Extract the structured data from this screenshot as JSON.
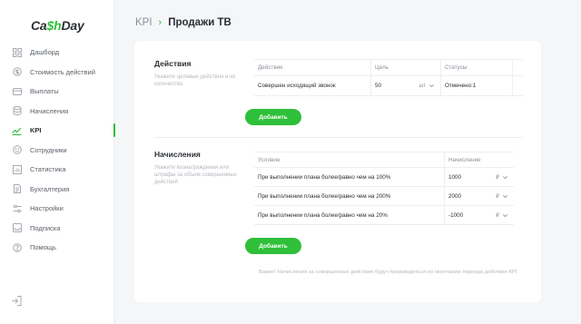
{
  "brand": {
    "name_pre": "Ca",
    "name_acc": "$h",
    "name_post": "Day",
    "accent_color": "#2fbf3a"
  },
  "sidebar": {
    "items": [
      {
        "label": "Дашборд",
        "icon": "dashboard-icon"
      },
      {
        "label": "Стоимость действий",
        "icon": "coin-icon"
      },
      {
        "label": "Выплаты",
        "icon": "wallet-icon"
      },
      {
        "label": "Начисления",
        "icon": "database-icon"
      },
      {
        "label": "KPI",
        "icon": "trend-icon",
        "active": true
      },
      {
        "label": "Сотрудники",
        "icon": "smile-icon"
      },
      {
        "label": "Статистика",
        "icon": "bar-chart-icon"
      },
      {
        "label": "Бухгалтерия",
        "icon": "document-icon"
      },
      {
        "label": "Настройки",
        "icon": "settings-icon"
      },
      {
        "label": "Подписка",
        "icon": "inbox-icon"
      },
      {
        "label": "Помощь",
        "icon": "help-icon"
      }
    ],
    "logout_icon": "logout-icon"
  },
  "header": {
    "crumb": "KPI",
    "separator": "›",
    "title": "Продажи ТВ"
  },
  "actions_section": {
    "title": "Действия",
    "description": "Укажите целевые действия и их количество",
    "columns": [
      "Действие",
      "Цель",
      "Статусы"
    ],
    "rows": [
      {
        "action": "Совершен исходящий звонок",
        "goal": "50",
        "unit": "шт",
        "status": "Отмечено:1"
      }
    ],
    "add_label": "Добавить"
  },
  "accruals_section": {
    "title": "Начисления",
    "description": "Укажите вознаграждения или штрафы за объем совершенных действий",
    "columns": [
      "Условие",
      "Начисление"
    ],
    "rows": [
      {
        "condition": "При выполнении плана более/равно чем на 100%",
        "amount": "1000",
        "currency": "₽"
      },
      {
        "condition": "При выполнении плана более/равно чем на 200%",
        "amount": "2000",
        "currency": "₽"
      },
      {
        "condition": "При выполнении плана более/равно чем на 20%",
        "amount": "-1000",
        "currency": "₽"
      }
    ],
    "add_label": "Добавить"
  },
  "note": "Важно! Начисления за совершенные действия будут производиться по окончанию периода действия KPI"
}
